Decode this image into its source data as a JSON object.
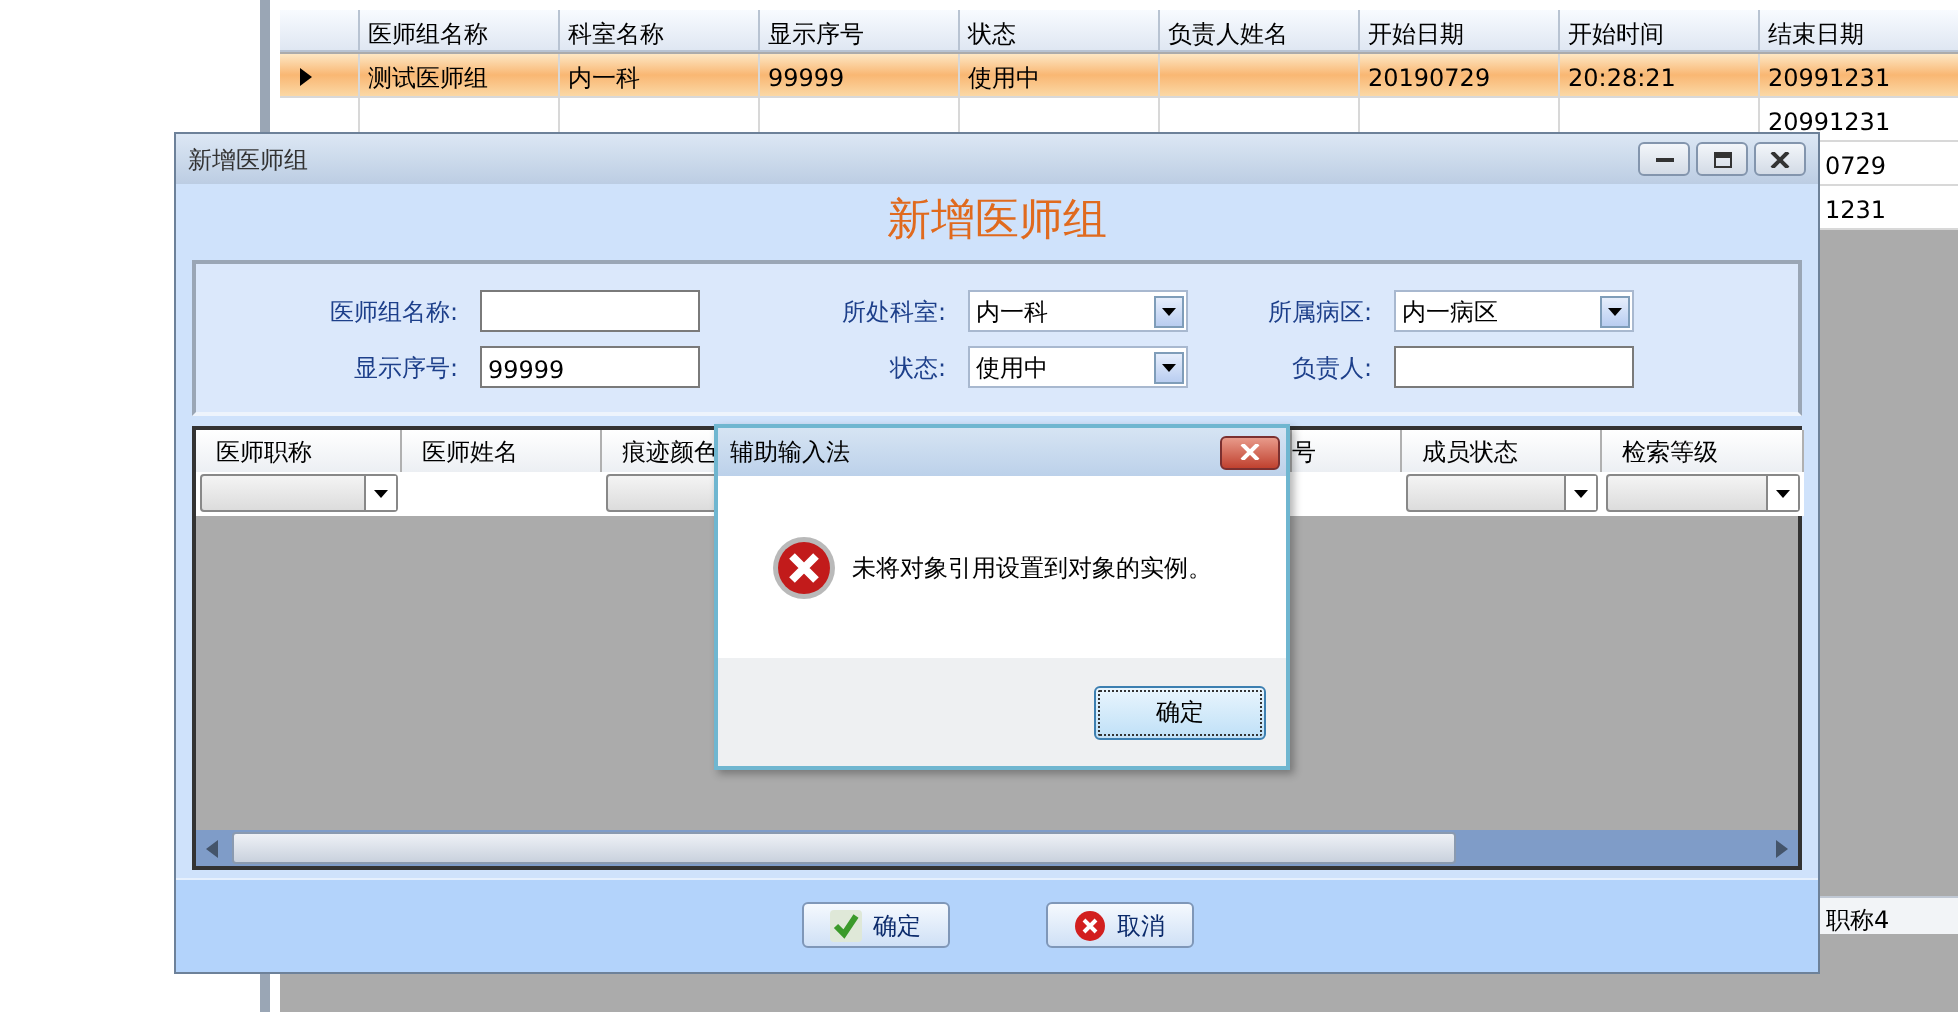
{
  "background_grid": {
    "columns": [
      "医师组名称",
      "科室名称",
      "显示序号",
      "状态",
      "负责人姓名",
      "开始日期",
      "开始时间",
      "结束日期"
    ],
    "rows": [
      {
        "selected": true,
        "cells": [
          "测试医师组",
          "内一科",
          "99999",
          "使用中",
          null,
          "20190729",
          "20:28:21",
          "20991231"
        ]
      },
      {
        "selected": false,
        "last_cell": "20991231"
      },
      {
        "selected": false,
        "last_cell": "0729"
      },
      {
        "selected": false,
        "last_cell": "1231"
      }
    ],
    "lower_grid_header": "职称4"
  },
  "dialog": {
    "title": "新增医师组",
    "heading": "新增医师组",
    "fields": [
      {
        "label": "医师组名称:",
        "kind": "text"
      },
      {
        "label": "所处科室:",
        "kind": "select",
        "value": "内一科"
      },
      {
        "label": "所属病区:",
        "kind": "select",
        "value": "内一病区"
      },
      {
        "label": "显示序号:",
        "kind": "text",
        "value": "99999"
      },
      {
        "label": "状态:",
        "kind": "select",
        "value": "使用中"
      },
      {
        "label": "负责人:",
        "kind": "text"
      }
    ],
    "member_grid": {
      "columns": [
        {
          "label": "医师职称",
          "kind": "combo"
        },
        {
          "label": "医师姓名",
          "kind": "text"
        },
        {
          "label": "痕迹颜色",
          "kind": "combo"
        },
        {
          "label": "号",
          "kind": "text"
        },
        {
          "label": "成员状态",
          "kind": "combo"
        },
        {
          "label": "检索等级",
          "kind": "combo"
        }
      ]
    },
    "buttons": [
      {
        "label": "确定",
        "kind": "ok"
      },
      {
        "label": "取消",
        "kind": "cancel"
      }
    ]
  },
  "message_box": {
    "title": "辅助输入法",
    "kind": "error",
    "message": "未将对象引用设置到对象的实例。",
    "button": "确定"
  }
}
